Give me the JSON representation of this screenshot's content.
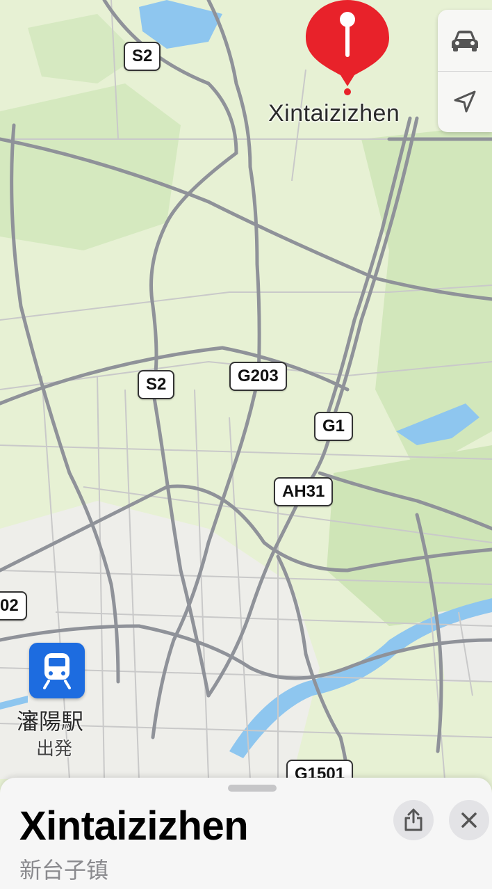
{
  "pin": {
    "label": "Xintaizizhen",
    "color": "#e8222a"
  },
  "road_shields": [
    {
      "id": "s2-top",
      "text": "S2"
    },
    {
      "id": "s2-mid",
      "text": "S2"
    },
    {
      "id": "g203",
      "text": "G203"
    },
    {
      "id": "g1",
      "text": "G1"
    },
    {
      "id": "ah31",
      "text": "AH31"
    },
    {
      "id": "edge",
      "text": "02"
    },
    {
      "id": "g1501",
      "text": "G1501"
    }
  ],
  "station": {
    "name": "瀋陽駅",
    "sub": "出発",
    "icon": "train-icon",
    "color": "#1d6ce0"
  },
  "controls": {
    "drive_icon": "car-icon",
    "locate_icon": "location-arrow-icon"
  },
  "sheet": {
    "title": "Xintaizizhen",
    "subtitle": "新台子镇",
    "share_icon": "share-icon",
    "close_icon": "close-icon"
  }
}
